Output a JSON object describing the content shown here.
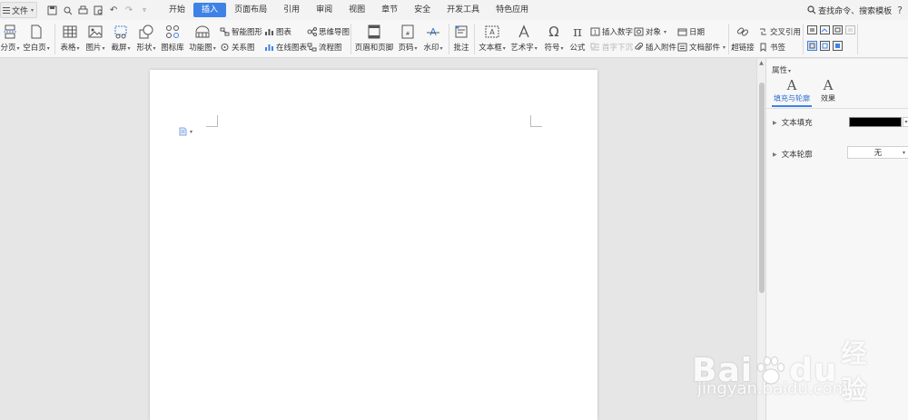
{
  "menubar": {
    "file_label": "文件",
    "tabs": [
      {
        "label": "开始",
        "active": false
      },
      {
        "label": "插入",
        "active": true
      },
      {
        "label": "页面布局",
        "active": false
      },
      {
        "label": "引用",
        "active": false
      },
      {
        "label": "审阅",
        "active": false
      },
      {
        "label": "视图",
        "active": false
      },
      {
        "label": "章节",
        "active": false
      },
      {
        "label": "安全",
        "active": false
      },
      {
        "label": "开发工具",
        "active": false
      },
      {
        "label": "特色应用",
        "active": false
      }
    ],
    "search_label": "查找命令、搜索模板",
    "help_label": "?"
  },
  "ribbon": {
    "page_break": "分页",
    "blank_page": "空白页",
    "table": "表格",
    "picture": "图片",
    "screenshot": "截屏",
    "shape": "形状",
    "icon_library": "图标库",
    "function_chart": "功能图",
    "smart_shape": "智能图形",
    "chart": "图表",
    "mind_map": "思维导图",
    "relation_chart": "关系图",
    "online_chart": "在线图表",
    "flowchart": "流程图",
    "header_footer": "页眉和页脚",
    "page_number": "页码",
    "watermark": "水印",
    "comment": "批注",
    "text_box": "文本框",
    "word_art": "艺术字",
    "symbol": "符号",
    "formula": "公式",
    "insert_number": "插入数字",
    "object": "对象",
    "date": "日期",
    "first_letter_sink": "首字下沉",
    "insert_attachment": "插入附件",
    "doc_parts": "文档部件",
    "hyperlink": "超链接",
    "cross_reference": "交叉引用",
    "bookmark": "书签"
  },
  "panel": {
    "title": "属性",
    "tabs": [
      {
        "label": "填充与轮廓",
        "icon_name": "text-fill-icon",
        "active": true
      },
      {
        "label": "效果",
        "icon_name": "text-effect-icon",
        "active": false
      }
    ],
    "text_fill_label": "文本填充",
    "text_fill_color": "#000000",
    "text_outline_label": "文本轮廓",
    "text_outline_value": "无"
  },
  "watermark": {
    "brand": "Bai",
    "brand_tail": "du",
    "brand_cn": "经验",
    "url": "jingyan.baidu.com"
  },
  "colors": {
    "accent": "#3e82e6"
  }
}
